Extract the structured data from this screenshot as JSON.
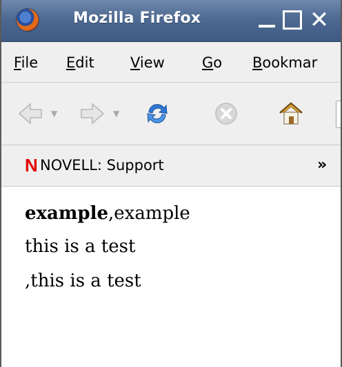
{
  "window": {
    "title": "Mozilla Firefox"
  },
  "menubar": {
    "items": [
      {
        "label": "File",
        "mnemonic": "F",
        "rest": "ile"
      },
      {
        "label": "Edit",
        "mnemonic": "E",
        "rest": "dit"
      },
      {
        "label": "View",
        "mnemonic": "V",
        "rest": "iew"
      },
      {
        "label": "Go",
        "mnemonic": "G",
        "rest": "o"
      },
      {
        "label": "Bookmar",
        "mnemonic": "B",
        "rest": "ookmar"
      }
    ]
  },
  "navbar": {
    "icons": [
      "back-icon",
      "forward-icon",
      "reload-icon",
      "stop-icon",
      "home-icon"
    ]
  },
  "bookmarks": {
    "items": [
      {
        "label": "NOVELL: Support",
        "logo": "N"
      }
    ],
    "overflow": "»"
  },
  "content": {
    "line1_bold": "example",
    "line1_rest": ",example",
    "line2": "this is a test",
    "line3": ",this is a test"
  },
  "colors": {
    "titlebar": "#4e6a92",
    "toolbar": "#efefef",
    "novell_red": "#e00000",
    "reload_blue": "#2e78d6"
  }
}
